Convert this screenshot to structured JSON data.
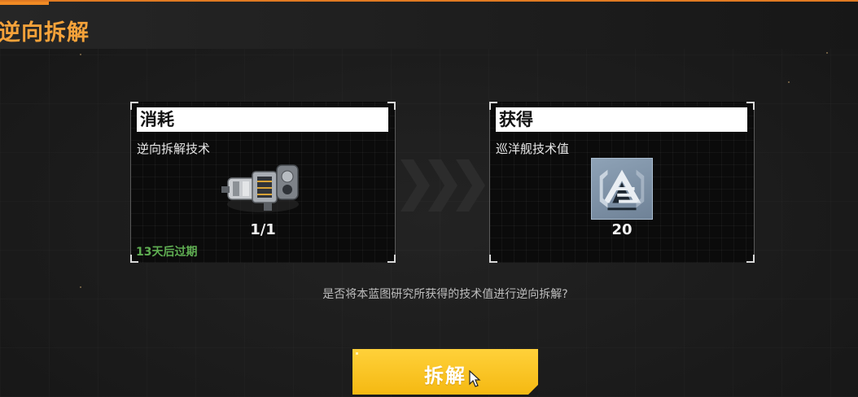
{
  "header": {
    "title": "逆向拆解"
  },
  "consume_panel": {
    "heading": "消耗",
    "item_name": "逆向拆解技术",
    "amount": "1/1",
    "expiry": "13天后过期",
    "icon": "engine-module-icon"
  },
  "gain_panel": {
    "heading": "获得",
    "item_name": "巡洋舰技术值",
    "amount": "20",
    "icon": "cruiser-tech-emblem-icon"
  },
  "arrows_icon": "triple-chevron-right-icon",
  "prompt": {
    "question": "是否将本蓝图研究所获得的技术值进行逆向拆解?"
  },
  "action": {
    "button_label": "拆解"
  },
  "colors": {
    "accent": "#f5a23a",
    "button": "#ffc822",
    "expiry": "#5fae52"
  }
}
